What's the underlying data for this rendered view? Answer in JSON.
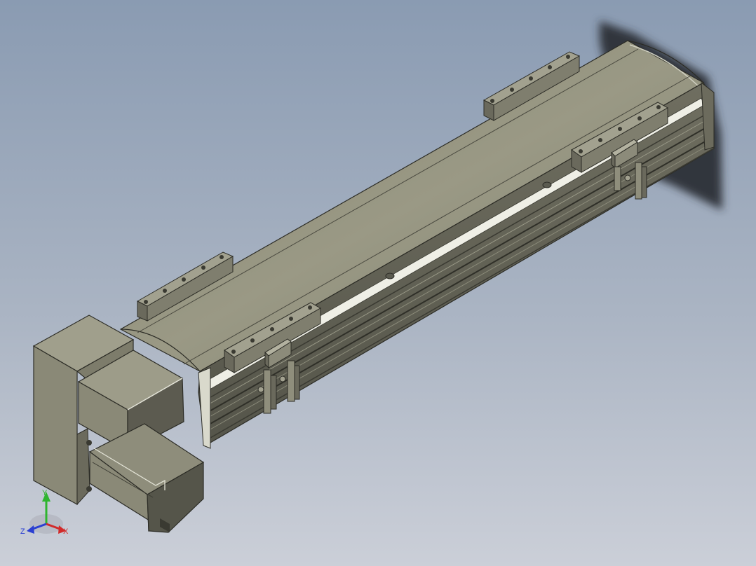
{
  "viewport": {
    "background_top": "#8a9bb2",
    "background_bottom": "#c9cdd6",
    "model_body_color": "#8c8b7a",
    "model_dark_color": "#55554c",
    "shadow_color": "#2b2f36"
  },
  "triad": {
    "x_label": "X",
    "y_label": "Y",
    "z_label": "Z",
    "x_color": "#d22a2a",
    "y_color": "#2fb52f",
    "z_color": "#2a3fd2"
  }
}
